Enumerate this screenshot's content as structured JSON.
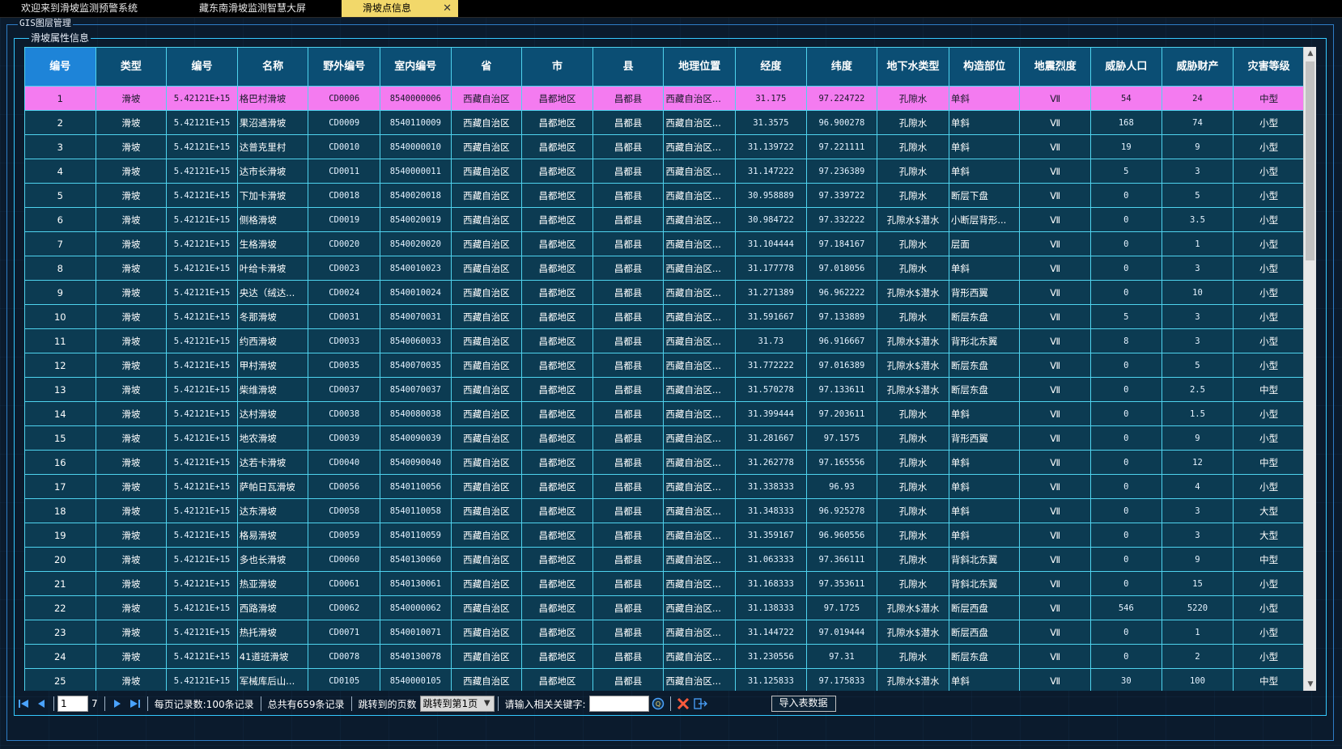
{
  "tabs": [
    {
      "label": "欢迎来到滑坡监测预警系统",
      "active": false
    },
    {
      "label": "藏东南滑坡监测智慧大屏",
      "active": false
    },
    {
      "label": "滑坡点信息",
      "active": true
    }
  ],
  "frames": {
    "outer_legend": "GIS图层管理",
    "inner_legend": "滑坡属性信息"
  },
  "grid": {
    "columns": [
      "编号",
      "类型",
      "编号",
      "名称",
      "野外编号",
      "室内编号",
      "省",
      "市",
      "县",
      "地理位置",
      "经度",
      "纬度",
      "地下水类型",
      "构造部位",
      "地震烈度",
      "威胁人口",
      "威胁财产",
      "灾害等级"
    ],
    "selected_column": 0,
    "highlighted_row": 0,
    "rows": [
      [
        "1",
        "滑坡",
        "5.42121E+15",
        "格巴村滑坡",
        "CD0006",
        "8540000006",
        "西藏自治区",
        "昌都地区",
        "昌都县",
        "西藏自治区...",
        "31.175",
        "97.224722",
        "孔隙水",
        "单斜",
        "Ⅶ",
        "54",
        "24",
        "中型"
      ],
      [
        "2",
        "滑坡",
        "5.42121E+15",
        "果沼通滑坡",
        "CD0009",
        "8540110009",
        "西藏自治区",
        "昌都地区",
        "昌都县",
        "西藏自治区...",
        "31.3575",
        "96.900278",
        "孔隙水",
        "单斜",
        "Ⅶ",
        "168",
        "74",
        "小型"
      ],
      [
        "3",
        "滑坡",
        "5.42121E+15",
        "达普克里村",
        "CD0010",
        "8540000010",
        "西藏自治区",
        "昌都地区",
        "昌都县",
        "西藏自治区...",
        "31.139722",
        "97.221111",
        "孔隙水",
        "单斜",
        "Ⅶ",
        "19",
        "9",
        "小型"
      ],
      [
        "4",
        "滑坡",
        "5.42121E+15",
        "达市长滑坡",
        "CD0011",
        "8540000011",
        "西藏自治区",
        "昌都地区",
        "昌都县",
        "西藏自治区...",
        "31.147222",
        "97.236389",
        "孔隙水",
        "单斜",
        "Ⅶ",
        "5",
        "3",
        "小型"
      ],
      [
        "5",
        "滑坡",
        "5.42121E+15",
        "下加卡滑坡",
        "CD0018",
        "8540020018",
        "西藏自治区",
        "昌都地区",
        "昌都县",
        "西藏自治区...",
        "30.958889",
        "97.339722",
        "孔隙水",
        "断层下盘",
        "Ⅶ",
        "0",
        "5",
        "小型"
      ],
      [
        "6",
        "滑坡",
        "5.42121E+15",
        "侧格滑坡",
        "CD0019",
        "8540020019",
        "西藏自治区",
        "昌都地区",
        "昌都县",
        "西藏自治区...",
        "30.984722",
        "97.332222",
        "孔隙水$潜水",
        "小断层背形...",
        "Ⅶ",
        "0",
        "3.5",
        "小型"
      ],
      [
        "7",
        "滑坡",
        "5.42121E+15",
        "生格滑坡",
        "CD0020",
        "8540020020",
        "西藏自治区",
        "昌都地区",
        "昌都县",
        "西藏自治区...",
        "31.104444",
        "97.184167",
        "孔隙水",
        "层面",
        "Ⅶ",
        "0",
        "1",
        "小型"
      ],
      [
        "8",
        "滑坡",
        "5.42121E+15",
        "叶给卡滑坡",
        "CD0023",
        "8540010023",
        "西藏自治区",
        "昌都地区",
        "昌都县",
        "西藏自治区...",
        "31.177778",
        "97.018056",
        "孔隙水",
        "单斜",
        "Ⅶ",
        "0",
        "3",
        "小型"
      ],
      [
        "9",
        "滑坡",
        "5.42121E+15",
        "央达（绒达...",
        "CD0024",
        "8540010024",
        "西藏自治区",
        "昌都地区",
        "昌都县",
        "西藏自治区...",
        "31.271389",
        "96.962222",
        "孔隙水$潜水",
        "背形西翼",
        "Ⅶ",
        "0",
        "10",
        "小型"
      ],
      [
        "10",
        "滑坡",
        "5.42121E+15",
        "冬那滑坡",
        "CD0031",
        "8540070031",
        "西藏自治区",
        "昌都地区",
        "昌都县",
        "西藏自治区...",
        "31.591667",
        "97.133889",
        "孔隙水",
        "断层东盘",
        "Ⅶ",
        "5",
        "3",
        "小型"
      ],
      [
        "11",
        "滑坡",
        "5.42121E+15",
        "约西滑坡",
        "CD0033",
        "8540060033",
        "西藏自治区",
        "昌都地区",
        "昌都县",
        "西藏自治区...",
        "31.73",
        "96.916667",
        "孔隙水$潜水",
        "背形北东翼",
        "Ⅶ",
        "8",
        "3",
        "小型"
      ],
      [
        "12",
        "滑坡",
        "5.42121E+15",
        "甲村滑坡",
        "CD0035",
        "8540070035",
        "西藏自治区",
        "昌都地区",
        "昌都县",
        "西藏自治区...",
        "31.772222",
        "97.016389",
        "孔隙水$潜水",
        "断层东盘",
        "Ⅶ",
        "0",
        "5",
        "小型"
      ],
      [
        "13",
        "滑坡",
        "5.42121E+15",
        "柴维滑坡",
        "CD0037",
        "8540070037",
        "西藏自治区",
        "昌都地区",
        "昌都县",
        "西藏自治区...",
        "31.570278",
        "97.133611",
        "孔隙水$潜水",
        "断层东盘",
        "Ⅶ",
        "0",
        "2.5",
        "中型"
      ],
      [
        "14",
        "滑坡",
        "5.42121E+15",
        "达村滑坡",
        "CD0038",
        "8540080038",
        "西藏自治区",
        "昌都地区",
        "昌都县",
        "西藏自治区...",
        "31.399444",
        "97.203611",
        "孔隙水",
        "单斜",
        "Ⅶ",
        "0",
        "1.5",
        "小型"
      ],
      [
        "15",
        "滑坡",
        "5.42121E+15",
        "地农滑坡",
        "CD0039",
        "8540090039",
        "西藏自治区",
        "昌都地区",
        "昌都县",
        "西藏自治区...",
        "31.281667",
        "97.1575",
        "孔隙水",
        "背形西翼",
        "Ⅶ",
        "0",
        "9",
        "小型"
      ],
      [
        "16",
        "滑坡",
        "5.42121E+15",
        "达若卡滑坡",
        "CD0040",
        "8540090040",
        "西藏自治区",
        "昌都地区",
        "昌都县",
        "西藏自治区...",
        "31.262778",
        "97.165556",
        "孔隙水",
        "单斜",
        "Ⅶ",
        "0",
        "12",
        "中型"
      ],
      [
        "17",
        "滑坡",
        "5.42121E+15",
        "萨帕日瓦滑坡",
        "CD0056",
        "8540110056",
        "西藏自治区",
        "昌都地区",
        "昌都县",
        "西藏自治区...",
        "31.338333",
        "96.93",
        "孔隙水",
        "单斜",
        "Ⅶ",
        "0",
        "4",
        "小型"
      ],
      [
        "18",
        "滑坡",
        "5.42121E+15",
        "达东滑坡",
        "CD0058",
        "8540110058",
        "西藏自治区",
        "昌都地区",
        "昌都县",
        "西藏自治区...",
        "31.348333",
        "96.925278",
        "孔隙水",
        "单斜",
        "Ⅶ",
        "0",
        "3",
        "大型"
      ],
      [
        "19",
        "滑坡",
        "5.42121E+15",
        "格易滑坡",
        "CD0059",
        "8540110059",
        "西藏自治区",
        "昌都地区",
        "昌都县",
        "西藏自治区...",
        "31.359167",
        "96.960556",
        "孔隙水",
        "单斜",
        "Ⅶ",
        "0",
        "3",
        "大型"
      ],
      [
        "20",
        "滑坡",
        "5.42121E+15",
        "多也长滑坡",
        "CD0060",
        "8540130060",
        "西藏自治区",
        "昌都地区",
        "昌都县",
        "西藏自治区...",
        "31.063333",
        "97.366111",
        "孔隙水",
        "背斜北东翼",
        "Ⅶ",
        "0",
        "9",
        "中型"
      ],
      [
        "21",
        "滑坡",
        "5.42121E+15",
        "热亚滑坡",
        "CD0061",
        "8540130061",
        "西藏自治区",
        "昌都地区",
        "昌都县",
        "西藏自治区...",
        "31.168333",
        "97.353611",
        "孔隙水",
        "背斜北东翼",
        "Ⅶ",
        "0",
        "15",
        "小型"
      ],
      [
        "22",
        "滑坡",
        "5.42121E+15",
        "西路滑坡",
        "CD0062",
        "8540000062",
        "西藏自治区",
        "昌都地区",
        "昌都县",
        "西藏自治区...",
        "31.138333",
        "97.1725",
        "孔隙水$潜水",
        "断层西盘",
        "Ⅶ",
        "546",
        "5220",
        "小型"
      ],
      [
        "23",
        "滑坡",
        "5.42121E+15",
        "热托滑坡",
        "CD0071",
        "8540010071",
        "西藏自治区",
        "昌都地区",
        "昌都县",
        "西藏自治区...",
        "31.144722",
        "97.019444",
        "孔隙水$潜水",
        "断层西盘",
        "Ⅶ",
        "0",
        "1",
        "小型"
      ],
      [
        "24",
        "滑坡",
        "5.42121E+15",
        "41道班滑坡",
        "CD0078",
        "8540130078",
        "西藏自治区",
        "昌都地区",
        "昌都县",
        "西藏自治区...",
        "31.230556",
        "97.31",
        "孔隙水",
        "断层东盘",
        "Ⅶ",
        "0",
        "2",
        "小型"
      ],
      [
        "25",
        "滑坡",
        "5.42121E+15",
        "军械库后山...",
        "CD0105",
        "8540000105",
        "西藏自治区",
        "昌都地区",
        "昌都县",
        "西藏自治区...",
        "31.125833",
        "97.175833",
        "孔隙水$潜水",
        "单斜",
        "Ⅶ",
        "30",
        "100",
        "中型"
      ]
    ]
  },
  "pager": {
    "current_page": "1",
    "total_pages": "7",
    "per_page_text": "每页记录数:100条记录",
    "total_text": "总共有659条记录",
    "jump_label": "跳转到的页数",
    "jump_select": "跳转到第1页",
    "search_label": "请输入相关关键字:",
    "search_value": "",
    "import_label": "导入表数据"
  },
  "colors": {
    "header_bg": "#0b4e74",
    "cell_bg": "#0c3b52",
    "grid_line": "#4fd3ee",
    "highlight_row": "#f47bf0",
    "selected_header": "#1e84d8",
    "active_tab": "#f2d86a"
  },
  "icons": {
    "first": "first-page-icon",
    "prev": "prev-page-icon",
    "next": "next-page-icon",
    "last": "last-page-icon",
    "search": "search-icon",
    "clear": "clear-icon",
    "exit": "exit-icon"
  }
}
